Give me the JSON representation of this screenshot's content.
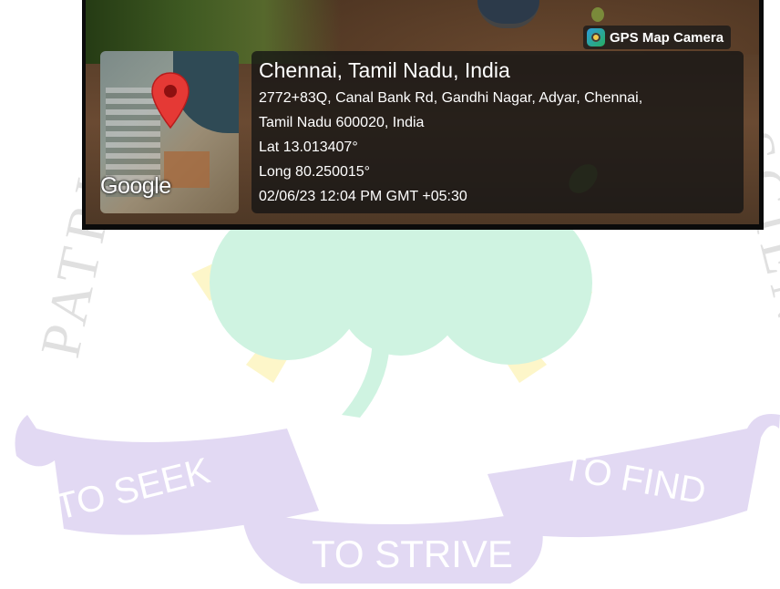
{
  "watermark": {
    "arc_left": "PATRICIAN",
    "arc_right": "SCIENCE",
    "ribbon_left": "TO SEEK",
    "ribbon_center": "TO STRIVE",
    "ribbon_right": "TO FIND",
    "colors": {
      "ribbon": "#e2d9f3",
      "ribbon_text": "#ffffff",
      "shamrock": "#cff3e1",
      "sun": "#fdf6c9",
      "arc_text": "#d8d8d8"
    }
  },
  "photo": {
    "badge": {
      "icon": "gps-map-camera-icon",
      "label": "GPS Map Camera"
    },
    "map": {
      "provider": "Google",
      "icon": "map-pin-icon",
      "pin_color": "#e53935"
    },
    "location": {
      "title": "Chennai, Tamil Nadu, India",
      "address_line_1": "2772+83Q, Canal Bank Rd, Gandhi Nagar, Adyar, Chennai,",
      "address_line_2": "Tamil Nadu 600020, India",
      "latitude": "Lat 13.013407°",
      "longitude": "Long 80.250015°",
      "datetime": "02/06/23 12:04 PM GMT +05:30"
    }
  }
}
